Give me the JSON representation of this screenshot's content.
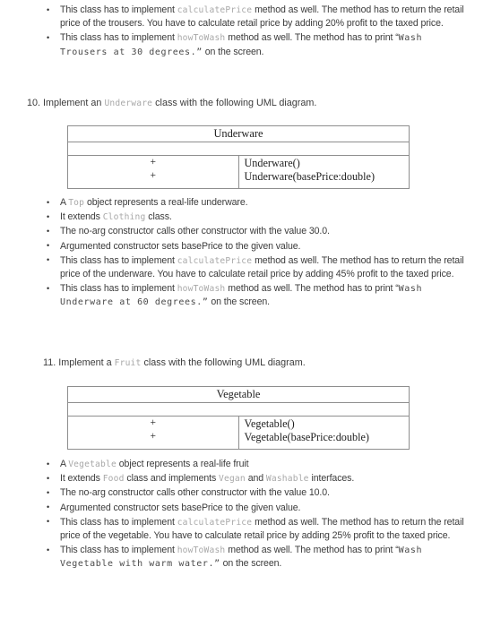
{
  "document": {
    "type": "exercise-sheet",
    "background": "#ffffff",
    "text_color": "#3b3b3b",
    "code_color": "#a8a8a8",
    "literal_color": "#4a4a4a",
    "table_border_color": "#8e8e8e"
  },
  "top_bullets": [
    {
      "parts": [
        {
          "t": "This class has to implement ",
          "s": "plain"
        },
        {
          "t": "calculatePrice",
          "s": "code"
        },
        {
          "t": " method as well. The method has to return the retail price of the trousers. You have to calculate retail price by adding 20% profit to the taxed price.",
          "s": "plain"
        }
      ]
    },
    {
      "parts": [
        {
          "t": "This class has to implement ",
          "s": "plain"
        },
        {
          "t": "howToWash",
          "s": "code"
        },
        {
          "t": " method as well. The method has to print “",
          "s": "plain"
        },
        {
          "t": "Wash Trousers at 30 degrees.”",
          "s": "lit"
        },
        {
          "t": " on the screen.",
          "s": "plain"
        }
      ]
    }
  ],
  "question10": {
    "number": "10.",
    "lead_before": " Implement an ",
    "class_name": "Underware",
    "lead_after": " class with the following UML diagram.",
    "uml": {
      "title": "Underware",
      "attributes": [],
      "methods": [
        {
          "visibility": "+",
          "signature": "Underware()"
        },
        {
          "visibility": "+",
          "signature": "Underware(basePrice:double)"
        }
      ]
    },
    "bullets": [
      {
        "parts": [
          {
            "t": "A ",
            "s": "plain"
          },
          {
            "t": "Top",
            "s": "code"
          },
          {
            "t": "  object represents a real-life underware.",
            "s": "plain"
          }
        ]
      },
      {
        "parts": [
          {
            "t": "It extends ",
            "s": "plain"
          },
          {
            "t": "Clothing",
            "s": "code"
          },
          {
            "t": "  class.",
            "s": "plain"
          }
        ]
      },
      {
        "parts": [
          {
            "t": "The no-arg constructor calls other constructor with the value 30.0.",
            "s": "plain"
          }
        ]
      },
      {
        "parts": [
          {
            "t": "Argumented constructor sets basePrice to the given value.",
            "s": "plain"
          }
        ]
      },
      {
        "parts": [
          {
            "t": "This class has to implement ",
            "s": "plain"
          },
          {
            "t": "calculatePrice",
            "s": "code"
          },
          {
            "t": " method as well. The method has to return the retail price of the underware. You have to calculate retail price by adding 45% profit to the taxed price.",
            "s": "plain"
          }
        ]
      },
      {
        "parts": [
          {
            "t": "This class has to implement ",
            "s": "plain"
          },
          {
            "t": "howToWash",
            "s": "code"
          },
          {
            "t": " method as well. The method has to print “",
            "s": "plain"
          },
          {
            "t": "Wash Underware at 60 degrees.”",
            "s": "lit"
          },
          {
            "t": " on the screen.",
            "s": "plain"
          }
        ]
      }
    ]
  },
  "question11": {
    "number": "11.",
    "lead_before": " Implement a ",
    "class_name": "Fruit",
    "lead_after": " class with the following UML diagram.",
    "uml": {
      "title": "Vegetable",
      "attributes": [],
      "methods": [
        {
          "visibility": "+",
          "signature": "Vegetable()"
        },
        {
          "visibility": "+",
          "signature": "Vegetable(basePrice:double)"
        }
      ]
    },
    "bullets": [
      {
        "parts": [
          {
            "t": "A ",
            "s": "plain"
          },
          {
            "t": "Vegetable",
            "s": "code"
          },
          {
            "t": "  object represents a real-life fruit",
            "s": "plain"
          }
        ]
      },
      {
        "parts": [
          {
            "t": "It extends ",
            "s": "plain"
          },
          {
            "t": "Food",
            "s": "code"
          },
          {
            "t": "  class and implements ",
            "s": "plain"
          },
          {
            "t": "Vegan",
            "s": "code"
          },
          {
            "t": "  and ",
            "s": "plain"
          },
          {
            "t": "Washable",
            "s": "code"
          },
          {
            "t": "  interfaces.",
            "s": "plain"
          }
        ]
      },
      {
        "parts": [
          {
            "t": "The no-arg constructor calls other constructor with the value 10.0.",
            "s": "plain"
          }
        ]
      },
      {
        "parts": [
          {
            "t": "Argumented constructor sets basePrice to the given value.",
            "s": "plain"
          }
        ]
      },
      {
        "parts": [
          {
            "t": "This class has to implement ",
            "s": "plain"
          },
          {
            "t": "calculatePrice",
            "s": "code"
          },
          {
            "t": " method as well. The method has to return the retail price of the vegetable. You have to calculate retail price by adding 25% profit to the taxed price.",
            "s": "plain"
          }
        ]
      },
      {
        "parts": [
          {
            "t": "This class has to implement ",
            "s": "plain"
          },
          {
            "t": "howToWash",
            "s": "code"
          },
          {
            "t": " method as well. The method has to print “",
            "s": "plain"
          },
          {
            "t": "Wash Vegetable with warm water.”",
            "s": "lit"
          },
          {
            "t": " on the screen.",
            "s": "plain"
          }
        ]
      }
    ]
  }
}
